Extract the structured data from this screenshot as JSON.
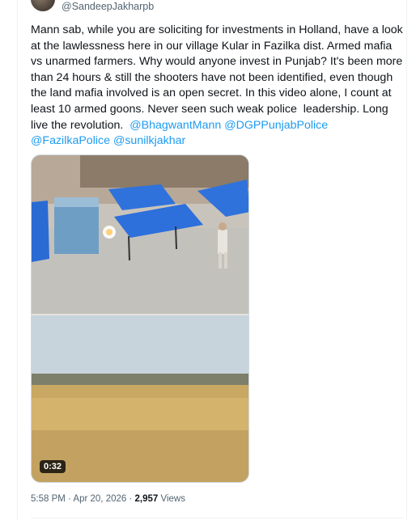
{
  "author": {
    "handle": "@SandeepJakharpb"
  },
  "tweet": {
    "text_plain": "Mann sab, while you are soliciting for investments in Holland, have a look at the lawlessness here in our village Kular in Fazilka dist. Armed mafia vs unarmed farmers. Why would anyone invest in Punjab? It's been more than 24 hours & still the shooters have not been identified, even though the land mafia involved is an open secret. In this video alone, I count at least 10 armed goons. Never seen such weak police  leadership. Long live the revolution.  ",
    "mention_1": "@BhagwantMann",
    "mention_2": "@DGPPunjabPolice",
    "mention_3": "@FazilkaPolice",
    "mention_4": "@sunilkjakhar"
  },
  "media": {
    "duration": "0:32"
  },
  "meta": {
    "time": "5:58 PM",
    "separator": " · ",
    "date": "Apr 20, 2026",
    "views_count": "2,957",
    "views_label": " Views"
  },
  "colors": {
    "link": "#1d9bf0",
    "text": "#0f1419",
    "muted": "#536471"
  }
}
